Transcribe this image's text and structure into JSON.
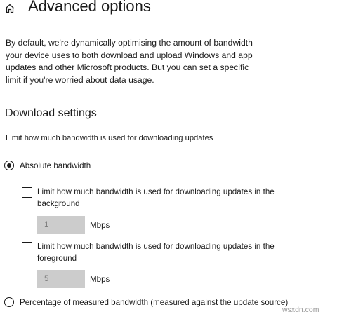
{
  "header": {
    "title": "Advanced options",
    "home_icon": "home-icon"
  },
  "intro": "By default, we're dynamically optimising the amount of bandwidth your device uses to both download and upload Windows and app updates and other Microsoft products. But you can set a specific limit if you're worried about data usage.",
  "download_settings": {
    "heading": "Download settings",
    "description": "Limit how much bandwidth is used for downloading updates",
    "absolute": {
      "label": "Absolute bandwidth",
      "selected": true
    },
    "background": {
      "label": "Limit how much bandwidth is used for downloading updates in the background",
      "checked": false,
      "value": "1",
      "unit": "Mbps"
    },
    "foreground": {
      "label": "Limit how much bandwidth is used for downloading updates in the foreground",
      "checked": false,
      "value": "5",
      "unit": "Mbps"
    },
    "percentage": {
      "label": "Percentage of measured bandwidth (measured against the update source)",
      "selected": false
    }
  },
  "watermark": "wsxdn.com",
  "colors": {
    "text": "#1a1a1a",
    "input_bg": "#cccccc",
    "input_text": "#7a7a7a"
  }
}
